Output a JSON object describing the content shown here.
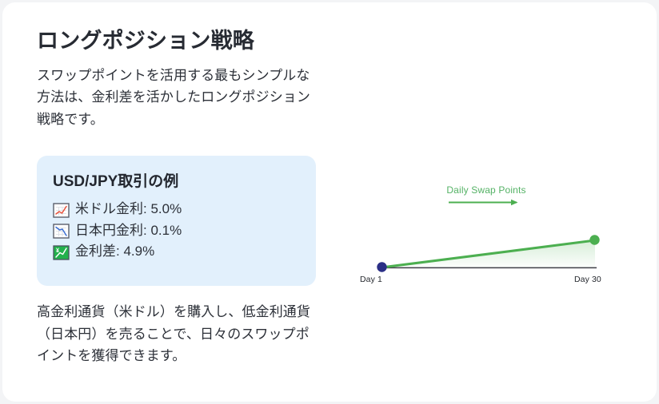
{
  "page": {
    "title": "ロングポジション戦略",
    "intro_paragraph": "スワップポイントを活用する最もシンプルな方法は、金利差を活かしたロングポジション戦略です。",
    "outro_paragraph": "高金利通貨（米ドル）を購入し、低金利通貨（日本円）を売ることで、日々のスワップポイントを獲得できます。"
  },
  "example_card": {
    "title": "USD/JPY取引の例",
    "background_color": "#e2f0fc",
    "items": [
      {
        "icon": "chart-increasing-icon",
        "label": "米ドル金利: 5.0%",
        "icon_color": "#e8503a"
      },
      {
        "icon": "chart-decreasing-icon",
        "label": "日本円金利: 0.1%",
        "icon_color": "#3b6fd4"
      },
      {
        "icon": "chart-increasing-yen-icon",
        "label": "金利差: 4.9%",
        "icon_color": "#22b14c"
      }
    ]
  },
  "chart_data": {
    "type": "area",
    "title": "",
    "annotation": "Daily Swap Points",
    "xlabel": "",
    "ylabel": "",
    "categories": [
      "Day 1",
      "Day 30"
    ],
    "x": [
      1,
      30
    ],
    "values": [
      0,
      43
    ],
    "tick_labels": [
      "Day 1",
      "Day 30"
    ],
    "series": [
      {
        "name": "Daily Swap Points",
        "values": [
          0,
          43
        ]
      }
    ],
    "xlim": [
      1,
      30
    ],
    "ylim": [
      0,
      50
    ],
    "grid": false,
    "legend": false,
    "colors": {
      "line": "#4caf50",
      "area_fill": "#4caf50",
      "start_point": "#2b2f86",
      "end_point": "#4caf50",
      "baseline": "#3f3f46",
      "annotation": "#54b265",
      "arrow": "#4caf50"
    },
    "markers": [
      {
        "name": "Day 1",
        "color": "#2b2f86",
        "value": 0
      },
      {
        "name": "Day 30",
        "color": "#4caf50",
        "value": 43
      }
    ]
  }
}
